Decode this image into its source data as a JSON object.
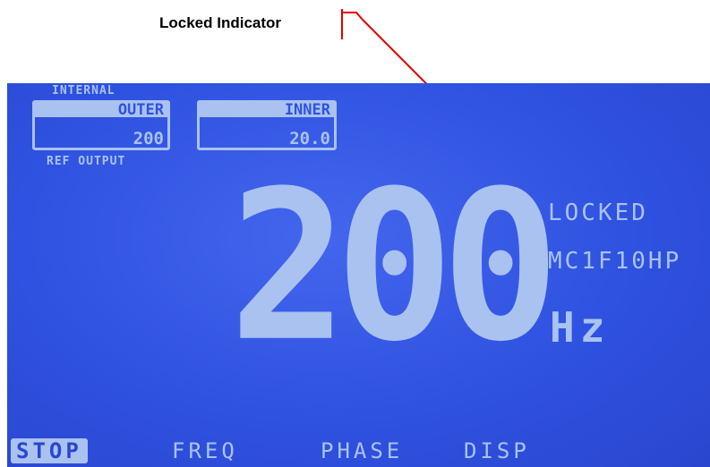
{
  "annotation": {
    "label": "Locked Indicator"
  },
  "display": {
    "ref_source": "INTERNAL",
    "outer": {
      "label": "OUTER",
      "value": "200"
    },
    "inner": {
      "label": "INNER",
      "value": "20.0"
    },
    "ref_output_label": "REF OUTPUT",
    "frequency": "200",
    "unit": "Hz",
    "lock_status": "LOCKED",
    "blade_model": "MC1F10HP"
  },
  "softkeys": [
    {
      "label": "STOP",
      "active": true
    },
    {
      "label": "FREQ",
      "active": false
    },
    {
      "label": "PHASE",
      "active": false
    },
    {
      "label": "DISP",
      "active": false
    }
  ],
  "colors": {
    "lcd_background": "#2f52e0",
    "lcd_foreground": "#a9c2ef",
    "arrow": "#e00000"
  }
}
